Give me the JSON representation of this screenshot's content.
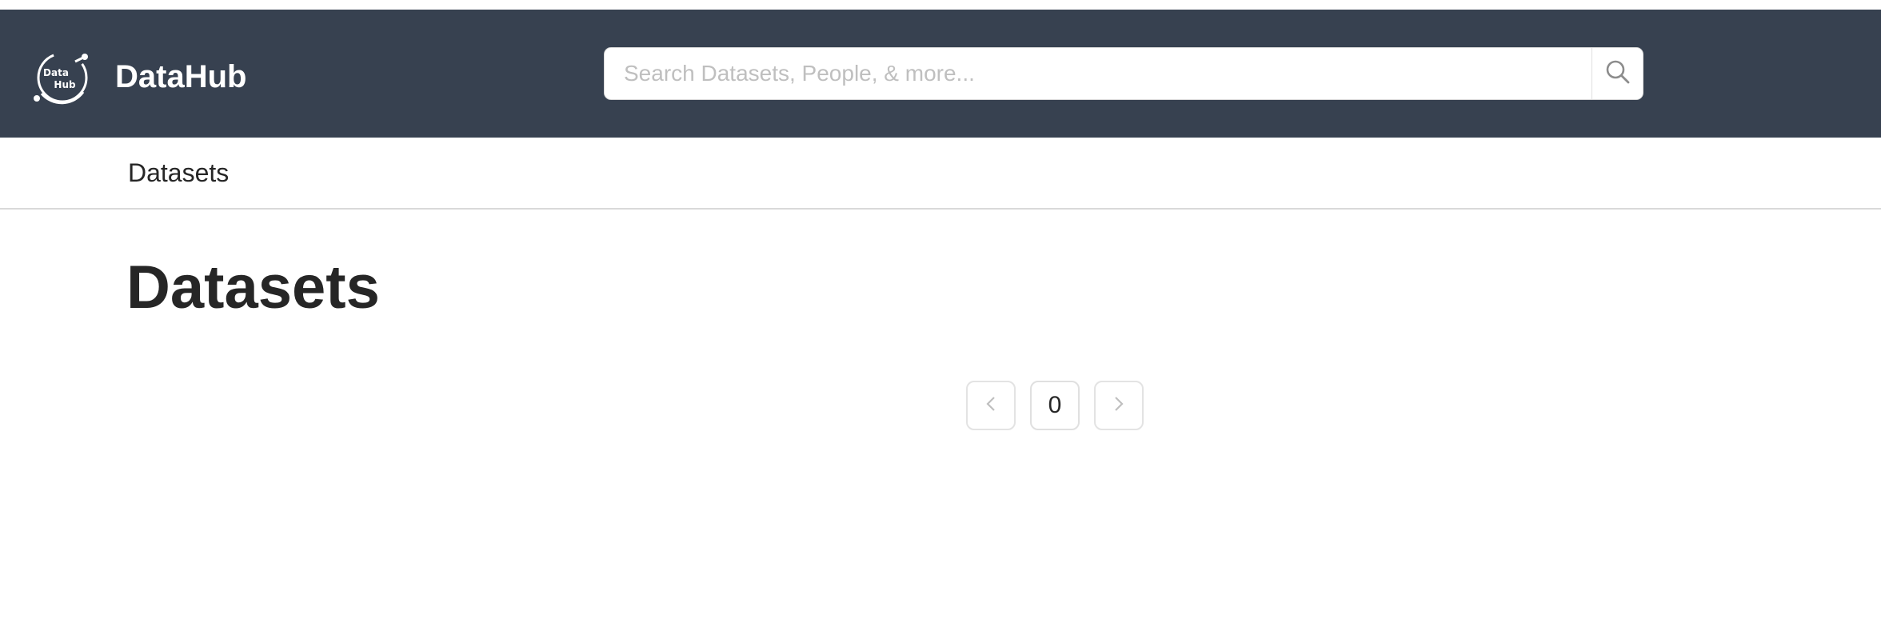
{
  "header": {
    "logo_text_line1": "Data",
    "logo_text_line2": "Hub",
    "brand": "DataHub",
    "search": {
      "placeholder": "Search Datasets, People, & more...",
      "value": ""
    },
    "background_color": "#374150"
  },
  "subnav": {
    "items": [
      {
        "label": "Datasets"
      }
    ]
  },
  "main": {
    "title": "Datasets"
  },
  "pagination": {
    "current_page": "0",
    "prev_icon": "chevron-left-icon",
    "next_icon": "chevron-right-icon"
  }
}
